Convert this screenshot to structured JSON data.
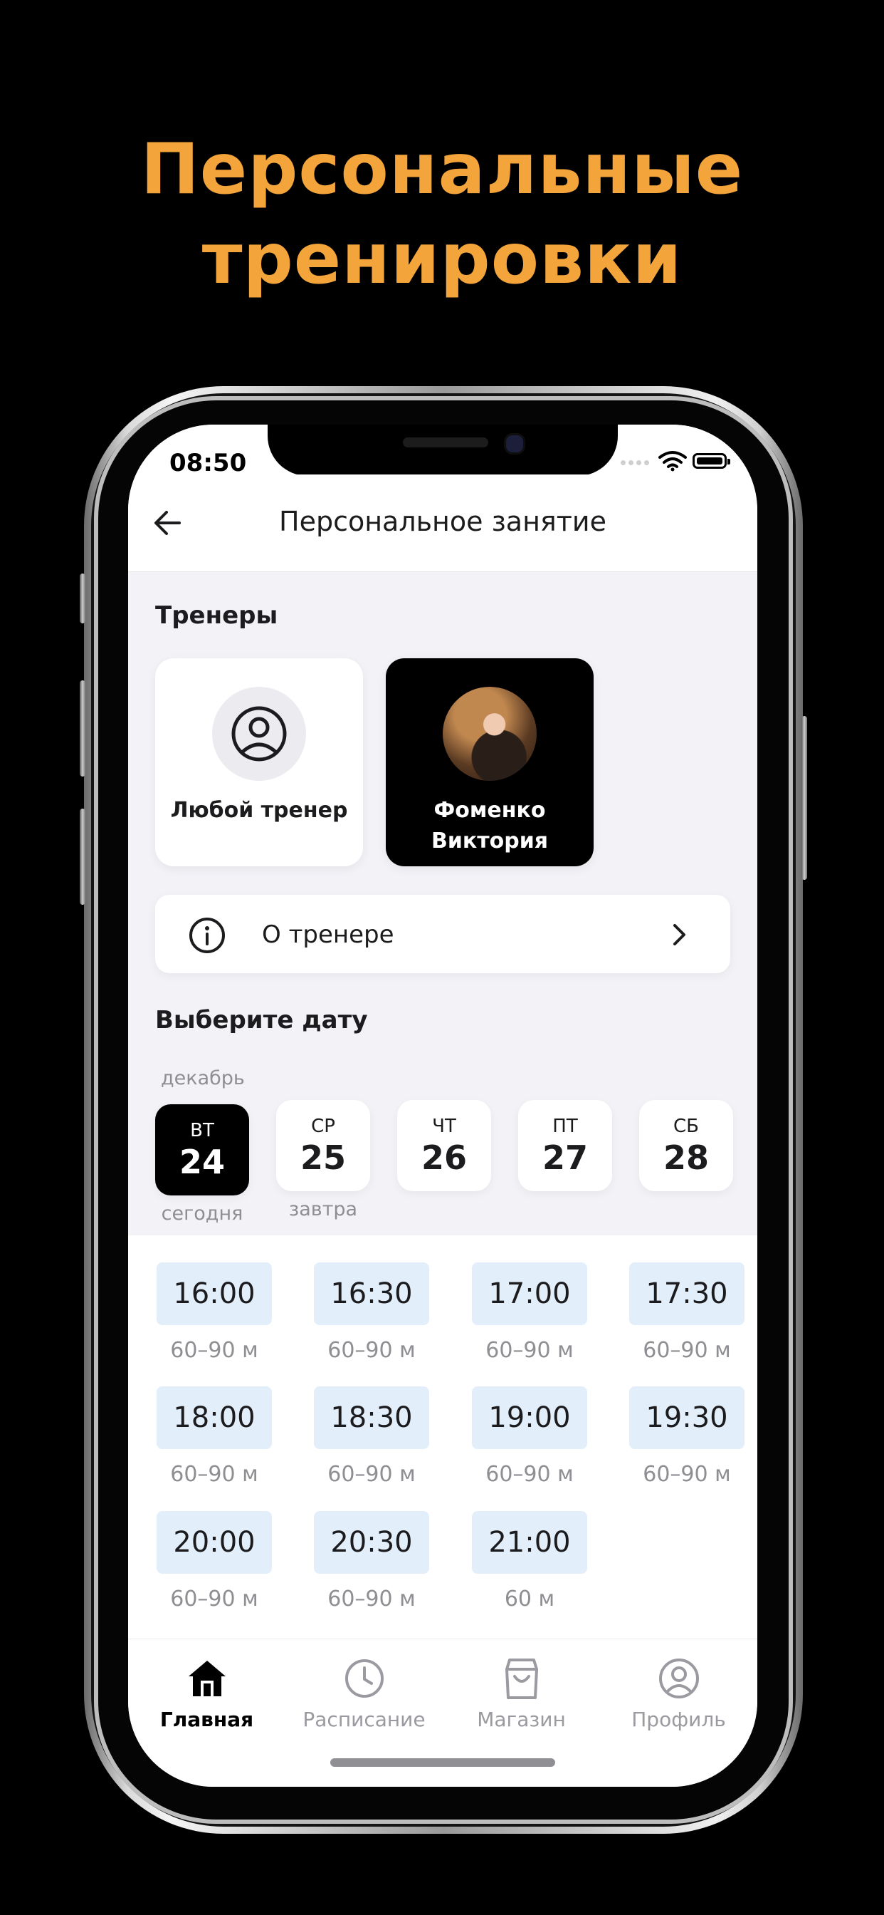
{
  "promo": {
    "line1": "Персональные",
    "line2": "тренировки",
    "color": "#F3A43A"
  },
  "status": {
    "time": "08:50"
  },
  "header": {
    "title": "Персональное занятие",
    "back_icon": "arrow-left-icon"
  },
  "trainers": {
    "title": "Тренеры",
    "items": [
      {
        "name_line1": "Любой тренер",
        "name_line2": "",
        "selected": false,
        "icon": "user-circle-icon"
      },
      {
        "name_line1": "Фоменко",
        "name_line2": "Виктория",
        "selected": true,
        "icon": "trainer-photo"
      }
    ],
    "about_label": "О тренере"
  },
  "date_picker": {
    "title": "Выберите дату",
    "month": "декабрь",
    "days": [
      {
        "weekday": "ВТ",
        "date": "24",
        "caption": "сегодня",
        "selected": true
      },
      {
        "weekday": "СР",
        "date": "25",
        "caption": "завтра",
        "selected": false
      },
      {
        "weekday": "ЧТ",
        "date": "26",
        "caption": "",
        "selected": false
      },
      {
        "weekday": "ПТ",
        "date": "27",
        "caption": "",
        "selected": false
      },
      {
        "weekday": "СБ",
        "date": "28",
        "caption": "",
        "selected": false
      }
    ]
  },
  "slots": [
    {
      "time": "16:00",
      "duration": "60–90 м"
    },
    {
      "time": "16:30",
      "duration": "60–90 м"
    },
    {
      "time": "17:00",
      "duration": "60–90 м"
    },
    {
      "time": "17:30",
      "duration": "60–90 м"
    },
    {
      "time": "18:00",
      "duration": "60–90 м"
    },
    {
      "time": "18:30",
      "duration": "60–90 м"
    },
    {
      "time": "19:00",
      "duration": "60–90 м"
    },
    {
      "time": "19:30",
      "duration": "60–90 м"
    },
    {
      "time": "20:00",
      "duration": "60–90 м"
    },
    {
      "time": "20:30",
      "duration": "60–90 м"
    },
    {
      "time": "21:00",
      "duration": "60 м"
    }
  ],
  "tabs": [
    {
      "label": "Главная",
      "icon": "home-icon",
      "active": true
    },
    {
      "label": "Расписание",
      "icon": "clock-icon",
      "active": false
    },
    {
      "label": "Магазин",
      "icon": "shopping-bag-icon",
      "active": false
    },
    {
      "label": "Профиль",
      "icon": "profile-icon",
      "active": false
    }
  ],
  "colors": {
    "slot_bg": "#E3EEFB",
    "screen_bg": "#F2F2F7",
    "accent": "#000000"
  }
}
